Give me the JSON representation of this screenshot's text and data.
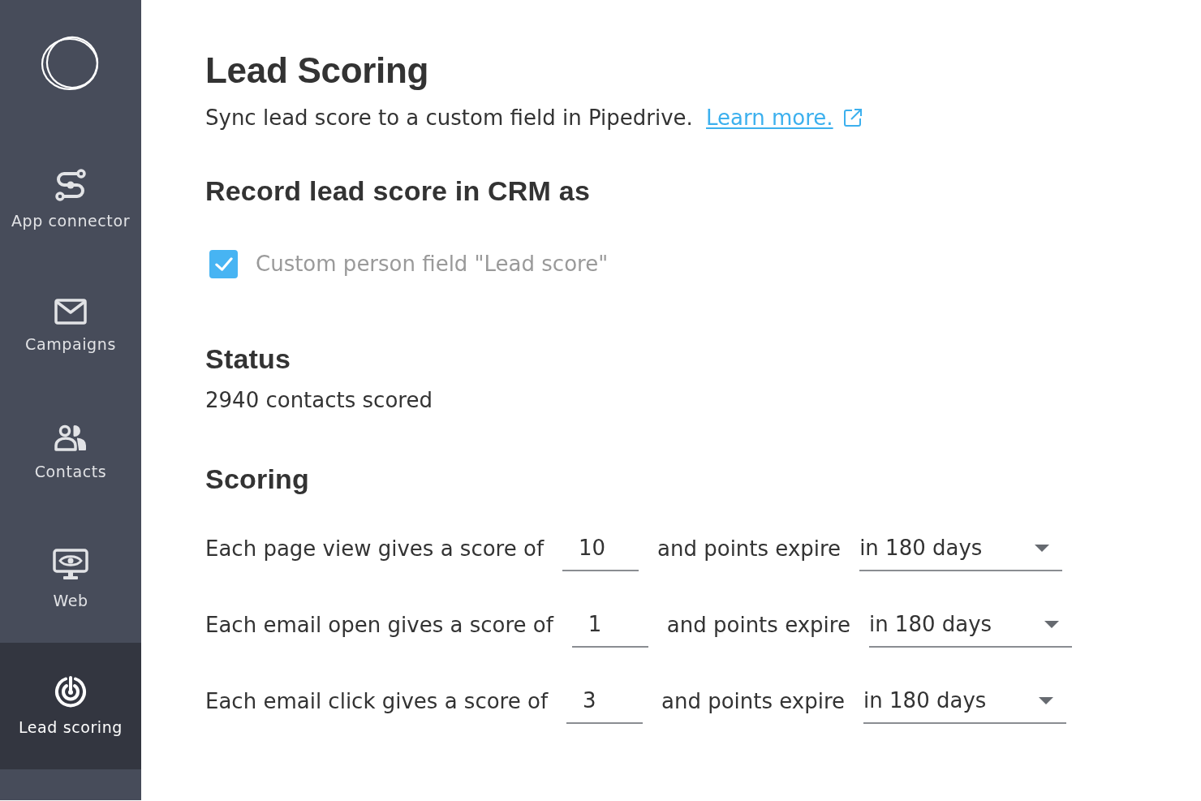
{
  "sidebar": {
    "items": [
      {
        "label": "App connector",
        "selected": false
      },
      {
        "label": "Campaigns",
        "selected": false
      },
      {
        "label": "Contacts",
        "selected": false
      },
      {
        "label": "Web",
        "selected": false
      },
      {
        "label": "Lead scoring",
        "selected": true
      }
    ]
  },
  "page": {
    "title": "Lead Scoring",
    "description": "Sync lead score to a custom field in Pipedrive.",
    "link": "Learn more."
  },
  "record_section": {
    "heading": "Record lead score in CRM as",
    "options": [
      {
        "label": "Custom person field \"Lead score\"",
        "checked": true
      }
    ]
  },
  "status_section": {
    "heading": "Status",
    "text": "2940 contacts scored"
  },
  "scoring_section": {
    "heading": "Scoring",
    "rows": [
      {
        "label": "Each page view gives a score of",
        "score": "10",
        "expire_label": "and points expire",
        "expiry": "in 180 days"
      },
      {
        "label": "Each email open gives a score of",
        "score": "1",
        "expire_label": "and points expire",
        "expiry": "in 180 days"
      },
      {
        "label": "Each email click gives a score of",
        "score": "3",
        "expire_label": "and points expire",
        "expiry": "in 180 days"
      }
    ]
  }
}
